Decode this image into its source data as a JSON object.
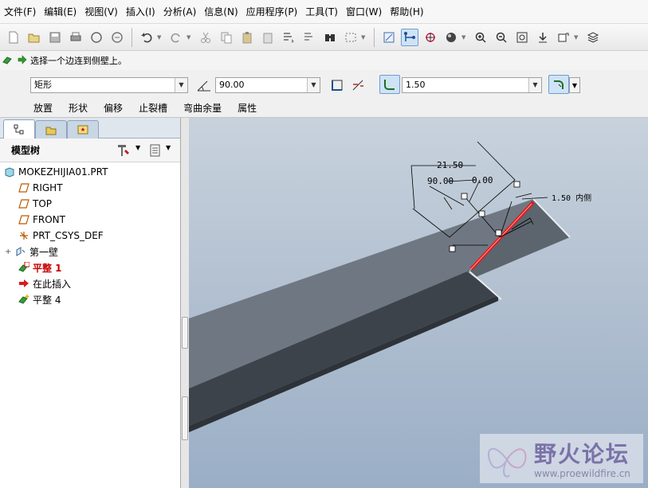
{
  "menu": [
    "文件(F)",
    "编辑(E)",
    "视图(V)",
    "插入(I)",
    "分析(A)",
    "信息(N)",
    "应用程序(P)",
    "工具(T)",
    "窗口(W)",
    "帮助(H)"
  ],
  "toolbar": {
    "icons": [
      "new-icon",
      "open-icon",
      "save-icon",
      "print-icon",
      "email-icon",
      "email-link-icon",
      "undo-icon",
      "redo-icon",
      "cut-icon",
      "copy-icon",
      "paste-icon",
      "paste-special-icon",
      "regenerate-icon",
      "regenerate-manager-icon",
      "find-icon",
      "select-box-icon",
      "named-view-icon",
      "sketch-icon",
      "spin-center-icon",
      "appearance-icon",
      "zoom-in-icon",
      "zoom-out-icon",
      "refit-icon",
      "reorient-icon",
      "saved-views-icon",
      "layers-icon"
    ]
  },
  "message": {
    "text": "选择一个边连到侧壁上。"
  },
  "dashboard": {
    "shape_value": "矩形",
    "angle_value": "90.00",
    "thickness_value": "1.50",
    "tabs": [
      "放置",
      "形状",
      "偏移",
      "止裂槽",
      "弯曲余量",
      "属性"
    ]
  },
  "model_tree": {
    "title": "模型树",
    "items": [
      {
        "label": "MOKEZHIJIA01.PRT",
        "icon": "part-icon",
        "indent": 0
      },
      {
        "label": "RIGHT",
        "icon": "datum-plane-icon",
        "indent": 1
      },
      {
        "label": "TOP",
        "icon": "datum-plane-icon",
        "indent": 1
      },
      {
        "label": "FRONT",
        "icon": "datum-plane-icon",
        "indent": 1
      },
      {
        "label": "PRT_CSYS_DEF",
        "icon": "csys-icon",
        "indent": 1
      },
      {
        "label": "第一壁",
        "icon": "first-wall-icon",
        "indent": 1
      },
      {
        "label": "平整 1",
        "icon": "flat-wall-icon",
        "indent": 1,
        "style": "red"
      },
      {
        "label": "在此插入",
        "icon": "insert-here-arrow-icon",
        "indent": 1
      },
      {
        "label": "平整 4",
        "icon": "flat-wall-new-icon",
        "indent": 1
      }
    ]
  },
  "viewport": {
    "dims": [
      "21.50",
      "90.00",
      "0.00",
      "1.50 内侧"
    ]
  },
  "watermark": {
    "title": "野火论坛",
    "url": "www.proewildfire.cn"
  }
}
